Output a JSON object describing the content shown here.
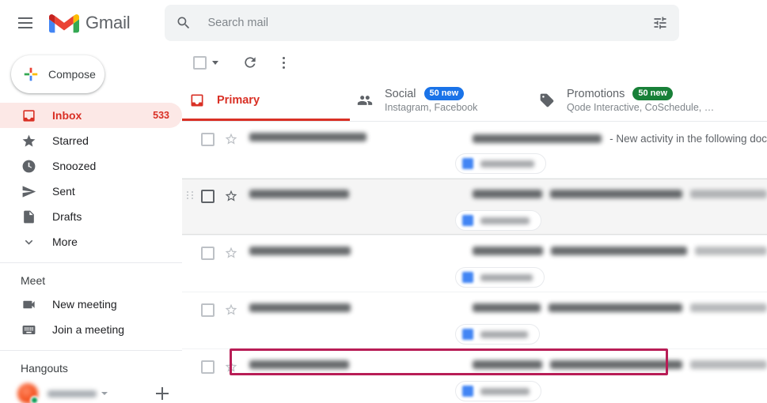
{
  "app": {
    "brand": "Gmail",
    "menu_icon": "hamburger-icon",
    "logo_icon": "gmail-logo-icon"
  },
  "search": {
    "placeholder": "Search mail",
    "value": "",
    "search_icon": "search-icon",
    "options_icon": "tune-options-icon"
  },
  "compose": {
    "label": "Compose",
    "icon": "plus-icon"
  },
  "sidebar": {
    "items": [
      {
        "label": "Inbox",
        "count": "533",
        "icon": "inbox-icon",
        "active": true
      },
      {
        "label": "Starred",
        "count": "",
        "icon": "star-icon",
        "active": false
      },
      {
        "label": "Snoozed",
        "count": "",
        "icon": "clock-icon",
        "active": false
      },
      {
        "label": "Sent",
        "count": "",
        "icon": "send-icon",
        "active": false
      },
      {
        "label": "Drafts",
        "count": "",
        "icon": "draft-icon",
        "active": false
      },
      {
        "label": "More",
        "count": "",
        "icon": "chevron-down-icon",
        "active": false
      }
    ],
    "meet": {
      "title": "Meet",
      "items": [
        {
          "label": "New meeting",
          "icon": "video-camera-icon"
        },
        {
          "label": "Join a meeting",
          "icon": "keyboard-icon"
        }
      ]
    },
    "hangouts": {
      "title": "Hangouts",
      "account_name": "",
      "status": "online",
      "add_icon": "plus-icon",
      "caret_icon": "chevron-down-icon"
    }
  },
  "toolbar": {
    "select_all_icon": "checkbox-icon",
    "select_all_caret_icon": "chevron-down-icon",
    "refresh_icon": "refresh-icon",
    "more_icon": "more-vertical-icon"
  },
  "tabs": [
    {
      "label": "Primary",
      "badge": "",
      "badge_color": "",
      "subtitle": "",
      "icon": "inbox-icon",
      "active": true
    },
    {
      "label": "Social",
      "badge": "50 new",
      "badge_color": "#1a73e8",
      "subtitle": "Instagram, Facebook",
      "icon": "people-icon",
      "active": false
    },
    {
      "label": "Promotions",
      "badge": "50 new",
      "badge_color": "#188038",
      "subtitle": "Qode Interactive, CoSchedule, …",
      "icon": "tag-icon",
      "active": false
    }
  ],
  "emails": [
    {
      "sender_redacted": true,
      "subject_redacted": true,
      "preview_visible": "- New activity in the following doc",
      "attachment_redacted": true,
      "hovered": false,
      "annotated": false
    },
    {
      "sender_redacted": true,
      "subject_redacted": true,
      "preview_visible": "",
      "attachment_redacted": true,
      "hovered": true,
      "annotated": false
    },
    {
      "sender_redacted": true,
      "subject_redacted": true,
      "preview_visible": "",
      "attachment_redacted": true,
      "hovered": false,
      "annotated": false
    },
    {
      "sender_redacted": true,
      "subject_redacted": true,
      "preview_visible": "",
      "attachment_redacted": true,
      "hovered": false,
      "annotated": false
    },
    {
      "sender_redacted": true,
      "subject_redacted": true,
      "preview_visible": "",
      "attachment_redacted": true,
      "hovered": false,
      "annotated": true
    }
  ],
  "colors": {
    "gmail_red": "#d93025",
    "inbox_highlight_bg": "#fce8e6",
    "social_badge": "#1a73e8",
    "promotions_badge": "#188038",
    "annotation_outline": "#b81d56",
    "attachment_blue": "#4285f4"
  }
}
